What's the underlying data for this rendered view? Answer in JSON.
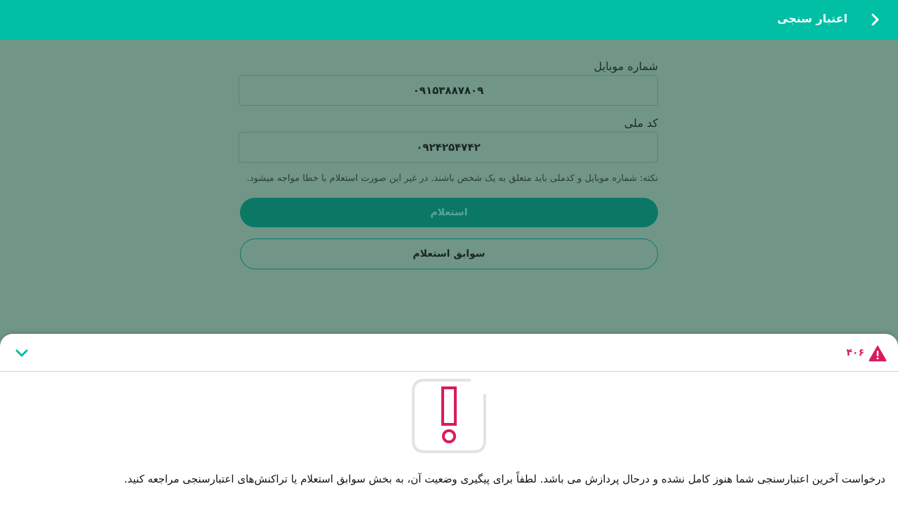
{
  "header": {
    "title": "اعتبار سنجی",
    "back_icon": "chevron-right-icon",
    "color": "#00bfa5"
  },
  "form": {
    "mobile": {
      "label": "شماره موبایل",
      "value": "۰۹۱۵۳۸۸۷۸۰۹"
    },
    "national_code": {
      "label": "کد ملی",
      "value": "۰۹۲۴۲۵۴۷۴۲"
    },
    "note": "نکته: شماره موبایل و کدملی باید متعلق به یک شخص باشند. در غیر این صورت استعلام با خطا مواجه میشود.",
    "submit_label": "استعلام",
    "history_label": "سوابق استعلام"
  },
  "sheet": {
    "error_code": "۴۰۶",
    "warning_icon": "warning-triangle-icon",
    "collapse_icon": "chevron-down-icon",
    "alert_icon": "exclamation-icon",
    "message": "درخواست آخرین اعتبارسنجی شما هنوز کامل نشده و درحال پردازش می باشد. لطفاً برای پیگیری وضعیت آن، به بخش سوابق استعلام یا تراکنش‌های اعتبارسنجی مراجعه کنید.",
    "accent_color": "#d81b60"
  }
}
